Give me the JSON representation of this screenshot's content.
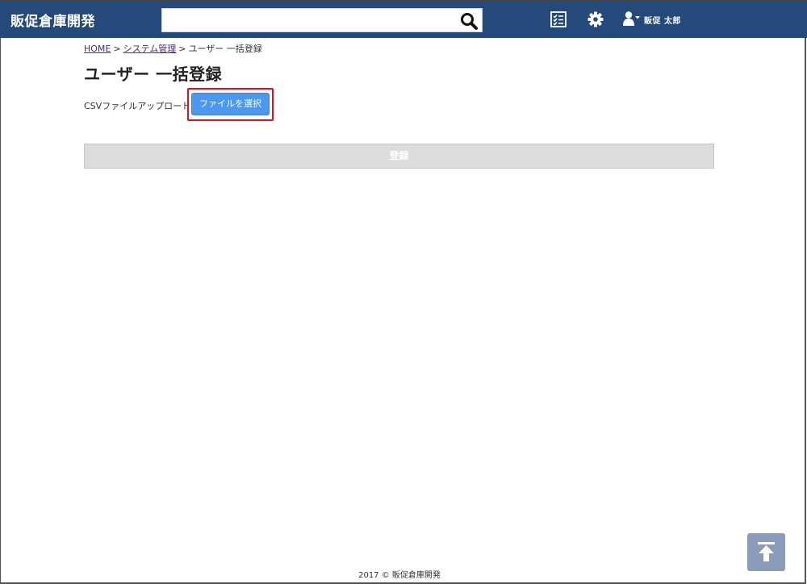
{
  "header": {
    "brand": "販促倉庫開発",
    "search": {
      "value": "",
      "placeholder": ""
    },
    "user_name": "販促 太郎"
  },
  "breadcrumb": {
    "home": "HOME",
    "separator": ">",
    "system": "システム管理",
    "current": "ユーザー 一括登録"
  },
  "page": {
    "title": "ユーザー 一括登録",
    "upload_label": "CSVファイルアップロード",
    "file_button": "ファイルを選択",
    "register_button": "登録"
  },
  "footer": {
    "text": "2017 © 販促倉庫開発"
  },
  "icons": {
    "search": "search-icon",
    "checklist": "checklist-icon",
    "settings": "gear-icon",
    "user": "user-icon",
    "to_top": "arrow-up-to-top-icon"
  },
  "colors": {
    "header_bg": "#234a7a",
    "primary_button": "#4a98f0",
    "highlight_border": "#e00f1e",
    "disabled_button": "#dcdcdc",
    "to_top_button": "#8a9bbb"
  }
}
